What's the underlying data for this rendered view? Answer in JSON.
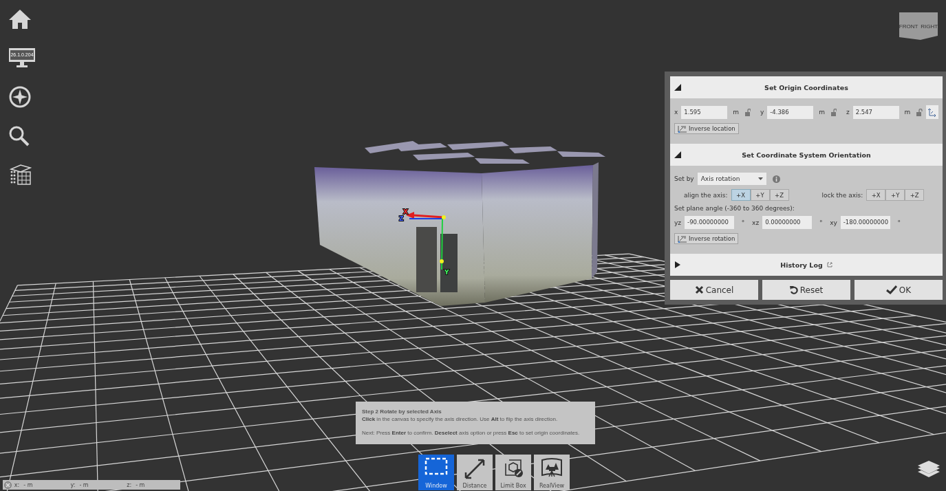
{
  "sidebar": {
    "monitor_label": "26.1.0.204"
  },
  "view_cube": {
    "faces": [
      "FRONT",
      "RIGHT"
    ]
  },
  "scene": {
    "gizmo_labels": [
      "X",
      "Z",
      "Y"
    ]
  },
  "panel": {
    "origin": {
      "title": "Set Origin Coordinates",
      "expanded": true,
      "fields": [
        {
          "label": "x",
          "value": "1.595",
          "unit": "m",
          "locked": false
        },
        {
          "label": "y",
          "value": "-4.386",
          "unit": "m",
          "locked": false
        },
        {
          "label": "z",
          "value": "2.547",
          "unit": "m",
          "locked": false
        }
      ],
      "inverse_button": "Inverse location"
    },
    "orientation": {
      "title": "Set Coordinate System Orientation",
      "expanded": true,
      "set_by_label": "Set by",
      "set_by_value": "Axis rotation",
      "align_label": "align the axis:",
      "align_axis": [
        {
          "label": "+X",
          "selected": true
        },
        {
          "label": "+Y",
          "selected": false
        },
        {
          "label": "+Z",
          "selected": false
        }
      ],
      "lock_label": "lock the axis:",
      "lock_axis": [
        {
          "label": "+X",
          "selected": false
        },
        {
          "label": "+Y",
          "selected": false
        },
        {
          "label": "+Z",
          "selected": false
        }
      ],
      "angle_caption": "Set plane angle (-360 to 360 degrees):",
      "angles": [
        {
          "label": "yz",
          "value": "-90.00000000",
          "unit": "°"
        },
        {
          "label": "xz",
          "value": "0.00000000",
          "unit": "°"
        },
        {
          "label": "xy",
          "value": "-180.00000000",
          "unit": "°"
        }
      ],
      "inverse_button": "Inverse rotation"
    },
    "history": {
      "title": "History Log",
      "expanded": false
    },
    "buttons": [
      {
        "kind": "cancel",
        "label": "Cancel"
      },
      {
        "kind": "reset",
        "label": "Reset"
      },
      {
        "kind": "ok",
        "label": "OK"
      }
    ]
  },
  "hint": {
    "title": "Step 2 Rotate by selected Axis",
    "lines": [
      "**Click** in the canvas to specify the axis direction. Use **Alt** to flip the axis direction.",
      "Next: Press **Enter** to confirm. **Deselect** axis option or press **Esc** to set origin coordinates."
    ]
  },
  "toolbar": [
    {
      "kind": "window",
      "label": "Window",
      "selected": true
    },
    {
      "kind": "distance",
      "label": "Distance",
      "selected": false
    },
    {
      "kind": "limit_box",
      "label": "Limit Box",
      "selected": false
    },
    {
      "kind": "realview",
      "label": "RealView",
      "selected": false
    }
  ],
  "coordinates": [
    {
      "label": "x:",
      "value": "- m"
    },
    {
      "label": "y:",
      "value": "- m"
    },
    {
      "label": "z:",
      "value": "- m"
    }
  ]
}
